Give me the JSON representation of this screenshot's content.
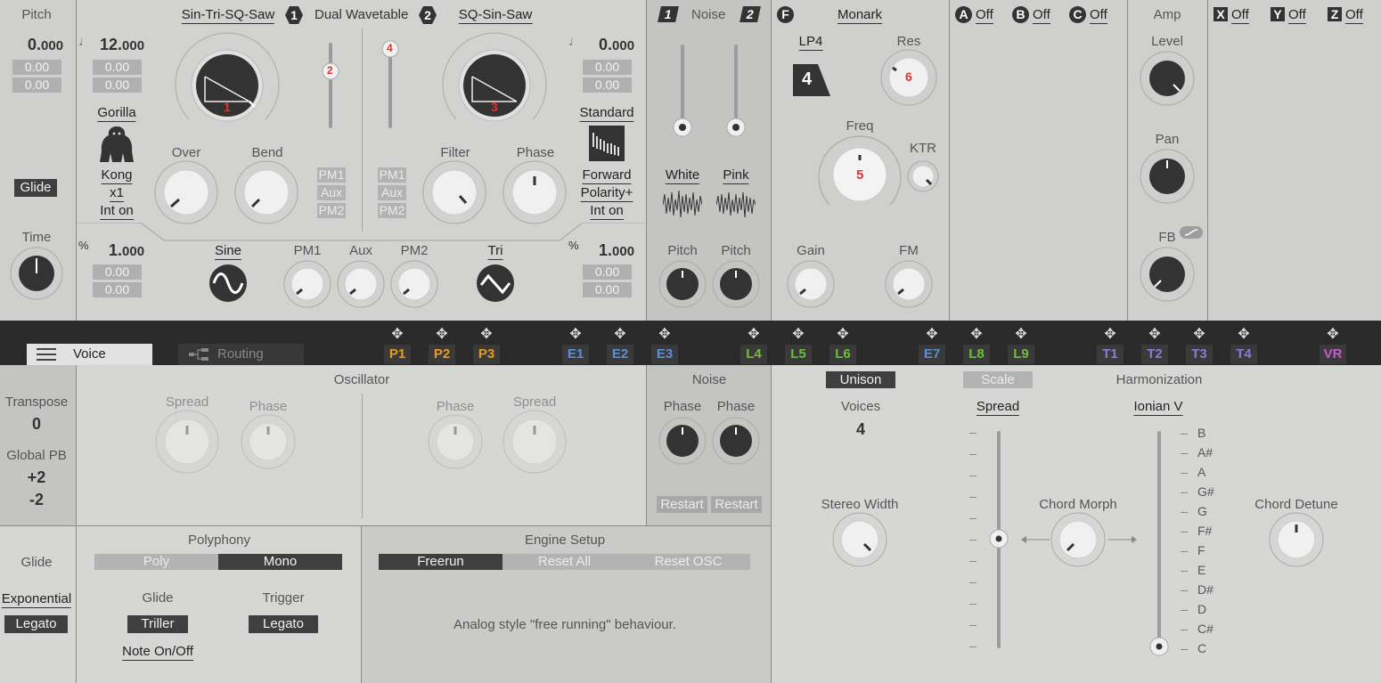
{
  "pitch": {
    "title": "Pitch",
    "value_int": "0.",
    "value_dec": "000",
    "fine1": "0.00",
    "fine2": "0.00",
    "glide_btn": "Glide",
    "time_label": "Time"
  },
  "osc1": {
    "note": "♩",
    "value_int": "12.",
    "value_dec": "000",
    "fine1": "0.00",
    "fine2": "0.00",
    "name": "Sin-Tri-SQ-Saw",
    "badge": "1",
    "knob_num": "1",
    "wave_name": "Gorilla",
    "wave_sub": "Kong",
    "mult": "x1",
    "interp": "Int on",
    "over": "Over",
    "bend": "Bend",
    "pm1": "PM1",
    "aux": "Aux",
    "pm2": "PM2",
    "slider_badge": "2"
  },
  "center": {
    "title": "Dual Wavetable",
    "badge": "2"
  },
  "osc2": {
    "note": "♩",
    "value_int": "0.",
    "value_dec": "000",
    "fine1": "0.00",
    "fine2": "0.00",
    "name": "SQ-Sin-Saw",
    "knob_num": "3",
    "wave_name": "Standard",
    "direction": "Forward",
    "polarity": "Polarity+",
    "interp": "Int on",
    "filter": "Filter",
    "phase": "Phase",
    "pm1": "PM1",
    "aux": "Aux",
    "pm2": "PM2",
    "slider_badge": "4"
  },
  "bottom_osc": {
    "pct1": "%",
    "v1_int": "1.",
    "v1_dec": "000",
    "v1_f1": "0.00",
    "v1_f2": "0.00",
    "pct2": "%",
    "v2_int": "1.",
    "v2_dec": "000",
    "v2_f1": "0.00",
    "v2_f2": "0.00",
    "sine": "Sine",
    "tri": "Tri",
    "pm1": "PM1",
    "aux": "Aux",
    "pm2": "PM2"
  },
  "noise": {
    "badge1": "1",
    "title": "Noise",
    "badge2": "2",
    "white": "White",
    "pink": "Pink",
    "pitch1": "Pitch",
    "pitch2": "Pitch"
  },
  "filter": {
    "badge": "F",
    "name": "Monark",
    "mode": "LP4",
    "mode_num": "4",
    "res": "Res",
    "res_num": "6",
    "freq": "Freq",
    "freq_num": "5",
    "ktr": "KTR",
    "gain": "Gain",
    "fm": "FM"
  },
  "mods_abc": [
    {
      "key": "A",
      "val": "Off"
    },
    {
      "key": "B",
      "val": "Off"
    },
    {
      "key": "C",
      "val": "Off"
    }
  ],
  "amp": {
    "title": "Amp",
    "level": "Level",
    "pan": "Pan",
    "fb": "FB"
  },
  "mods_xyz": [
    {
      "key": "X",
      "val": "Off"
    },
    {
      "key": "Y",
      "val": "Off"
    },
    {
      "key": "Z",
      "val": "Off"
    }
  ],
  "nav": {
    "voice": "Voice",
    "routing": "Routing",
    "slots": [
      {
        "name": "P1",
        "color": "#e89a1e"
      },
      {
        "name": "P2",
        "color": "#e89a1e"
      },
      {
        "name": "P3",
        "color": "#e89a1e"
      },
      {
        "name": "E1",
        "color": "#5a8fd8"
      },
      {
        "name": "E2",
        "color": "#5a8fd8"
      },
      {
        "name": "E3",
        "color": "#5a8fd8"
      },
      {
        "name": "L4",
        "color": "#6cbf3c"
      },
      {
        "name": "L5",
        "color": "#6cbf3c"
      },
      {
        "name": "L6",
        "color": "#6cbf3c"
      },
      {
        "name": "E7",
        "color": "#5a8fd8"
      },
      {
        "name": "L8",
        "color": "#6cbf3c"
      },
      {
        "name": "L9",
        "color": "#6cbf3c"
      },
      {
        "name": "T1",
        "color": "#8c7ad8"
      },
      {
        "name": "T2",
        "color": "#8c7ad8"
      },
      {
        "name": "T3",
        "color": "#8c7ad8"
      },
      {
        "name": "T4",
        "color": "#8c7ad8"
      },
      {
        "name": "VR",
        "color": "#c85ad0"
      }
    ]
  },
  "voice": {
    "transpose": "Transpose",
    "transpose_val": "0",
    "global_pb": "Global PB",
    "pb_up": "+2",
    "pb_down": "-2",
    "oscillator": "Oscillator",
    "spread1": "Spread",
    "phase1": "Phase",
    "phase2": "Phase",
    "spread2": "Spread",
    "noise": "Noise",
    "noise_phase1": "Phase",
    "noise_phase2": "Phase",
    "restart1": "Restart",
    "restart2": "Restart"
  },
  "unison": {
    "unison_btn": "Unison",
    "scale_btn": "Scale",
    "harmonization": "Harmonization",
    "voices": "Voices",
    "voices_val": "4",
    "spread": "Spread",
    "ionian": "Ionian V",
    "stereo_width": "Stereo Width",
    "chord_morph": "Chord Morph",
    "chord_detune": "Chord Detune",
    "notes": [
      "B",
      "A#",
      "A",
      "G#",
      "G",
      "F#",
      "F",
      "E",
      "D#",
      "D",
      "C#",
      "C"
    ]
  },
  "glide": {
    "label": "Glide",
    "mode": "Exponential",
    "legato": "Legato"
  },
  "polyphony": {
    "title": "Polyphony",
    "poly": "Poly",
    "mono": "Mono",
    "glide": "Glide",
    "trigger": "Trigger",
    "triller": "Triller",
    "legato": "Legato",
    "note_onoff": "Note On/Off"
  },
  "engine": {
    "title": "Engine Setup",
    "freerun": "Freerun",
    "reset_all": "Reset All",
    "reset_osc": "Reset OSC",
    "desc": "Analog style \"free running\" behaviour."
  }
}
